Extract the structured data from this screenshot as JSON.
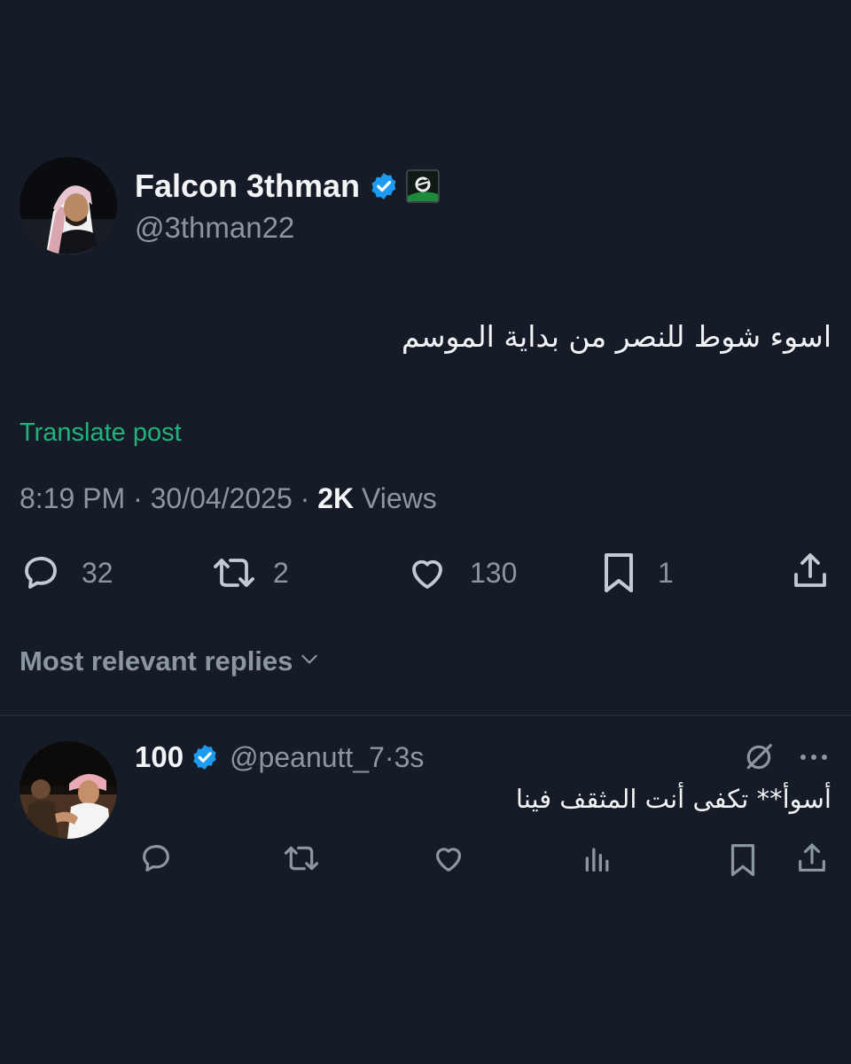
{
  "post": {
    "author_name": "Falcon 3thman",
    "author_handle": "@3thman22",
    "text": "اسوء شوط للنصر من بداية الموسم",
    "translate_label": "Translate post",
    "time": "8:19 PM",
    "date": "30/04/2025",
    "views_count": "2K",
    "views_label": "Views",
    "stats": {
      "replies": "32",
      "reposts": "2",
      "likes": "130",
      "bookmarks": "1"
    }
  },
  "replies_sort_label": "Most relevant replies",
  "reply": {
    "author_name": "100",
    "author_handle": "@peanutt_7",
    "age": "3s",
    "text": "أسوأ** تكفى أنت المثقف فينا"
  },
  "colors": {
    "background": "#161c27",
    "accent_verified": "#1d9bf0",
    "translate": "#1fb57a",
    "muted": "#8b96a3"
  },
  "icons": [
    "verified-badge-icon",
    "affiliate-badge-icon",
    "reply-icon",
    "repost-icon",
    "like-icon",
    "bookmark-icon",
    "share-icon",
    "chevron-down-icon",
    "grok-icon",
    "more-icon",
    "views-icon"
  ]
}
